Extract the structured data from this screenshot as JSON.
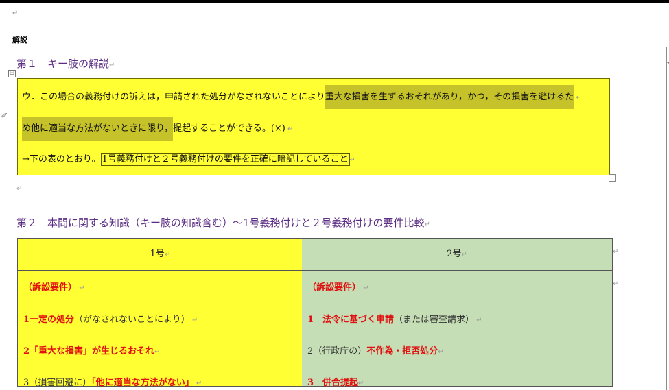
{
  "page": {
    "para_mark": "↵",
    "kaisetsu_label": "解説",
    "anchor_icon": "✐",
    "table_move_icon": "⊞",
    "right_marker": "◂"
  },
  "section1": {
    "heading": "第１　キー肢の解説",
    "answer": {
      "line1_plain": "ウ．この場合の義務付けの訴えは，申請された処分がなされないことにより",
      "line1_highlight": "重大な損害を生ずるおそれがあり，かつ，その損害を避けるた",
      "line2_highlight": "め他に適当な方法がないときに限り，",
      "line2_plain": "提起することができる。(×)",
      "line3_plain": "→下の表のとおり。",
      "line3_boxed": "1号義務付けと２号義務付けの要件を正確に暗記していること"
    }
  },
  "section2": {
    "heading": "第２　本問に関する知識（キー肢の知識含む）～1号義務付けと２号義務付けの要件比較",
    "table": {
      "headers": [
        "1号",
        "2号"
      ],
      "left": [
        {
          "red": "（訴訟要件）",
          "plain": ""
        },
        {
          "red": "1一定の処分",
          "plain": "（がなされないことにより）"
        },
        {
          "red": "2「重大な損害」が生じるおそれ",
          "plain": ""
        },
        {
          "pre": "3（損害回避に）",
          "red": "「他に適当な方法がない」",
          "plain": ""
        }
      ],
      "right": [
        {
          "red": "（訴訟要件）",
          "plain": ""
        },
        {
          "pre": "",
          "red": "1　法令に基づく申請",
          "plain": "（または審査請求）"
        },
        {
          "pre": "2（行政庁の）",
          "red": "不作為・拒否処分",
          "plain": ""
        },
        {
          "pre": "",
          "red": "3　併合提起",
          "plain": ""
        }
      ]
    }
  }
}
